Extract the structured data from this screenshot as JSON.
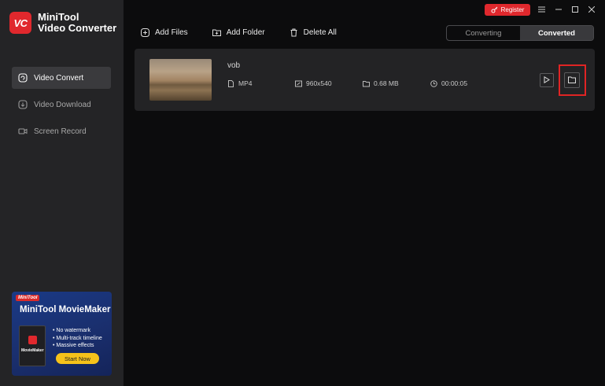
{
  "app": {
    "name_line1": "MiniTool",
    "name_line2": "Video Converter",
    "logo_text": "VC"
  },
  "sidebar": {
    "items": [
      {
        "label": "Video Convert",
        "icon": "convert-icon",
        "active": true
      },
      {
        "label": "Video Download",
        "icon": "download-icon",
        "active": false
      },
      {
        "label": "Screen Record",
        "icon": "camera-icon",
        "active": false
      }
    ]
  },
  "promo": {
    "brand": "MiniTool",
    "title": "MiniTool MovieMaker",
    "box_label": "MovieMaker",
    "features": [
      "No watermark",
      "Multi-track timeline",
      "Massive effects"
    ],
    "cta": "Start Now"
  },
  "toolbar": {
    "add_files": "Add Files",
    "add_folder": "Add Folder",
    "delete_all": "Delete All"
  },
  "header": {
    "register": "Register"
  },
  "tabs": {
    "converting": "Converting",
    "converted": "Converted",
    "active": "converted"
  },
  "file": {
    "name": "vob",
    "format": "MP4",
    "resolution": "960x540",
    "size": "0.68 MB",
    "duration": "00:00:05"
  },
  "colors": {
    "accent": "#e0282d",
    "highlight": "#e02424",
    "promo_cta": "#f6c21a"
  }
}
